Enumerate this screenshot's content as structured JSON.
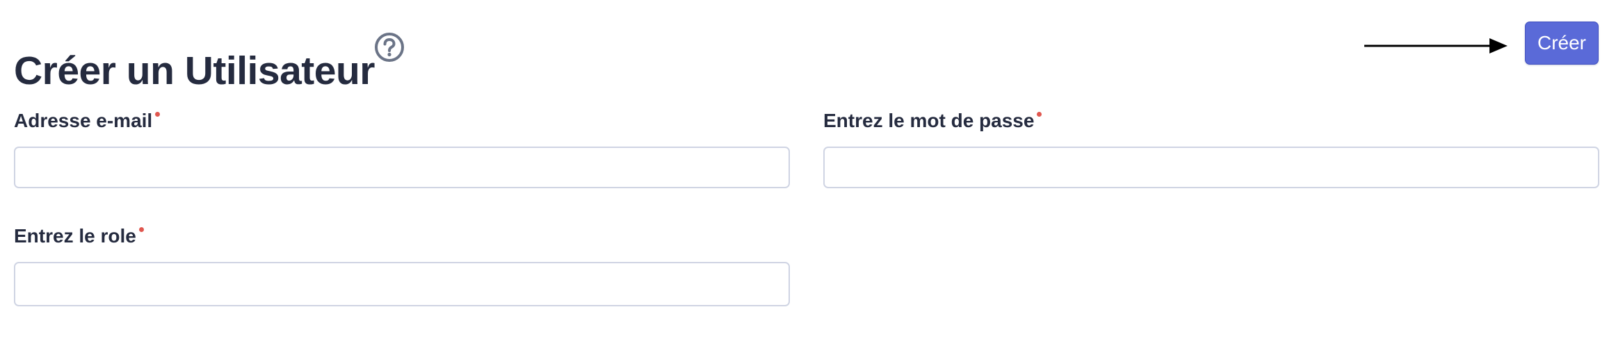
{
  "header": {
    "title": "Créer un Utilisateur",
    "help_icon": "question-circle-icon",
    "arrow_icon": "arrow-right-icon",
    "create_label": "Créer"
  },
  "form": {
    "email": {
      "label": "Adresse e-mail",
      "required": true,
      "value": "",
      "placeholder": ""
    },
    "password": {
      "label": "Entrez le mot de passe",
      "required": true,
      "value": "",
      "placeholder": ""
    },
    "role": {
      "label": "Entrez le role",
      "required": true,
      "value": "",
      "placeholder": ""
    }
  },
  "colors": {
    "primary": "#5a6ad8",
    "required": "#e0574f",
    "text": "#252b3f",
    "input_border": "#cfd4e3",
    "help_icon": "#6b7487"
  }
}
